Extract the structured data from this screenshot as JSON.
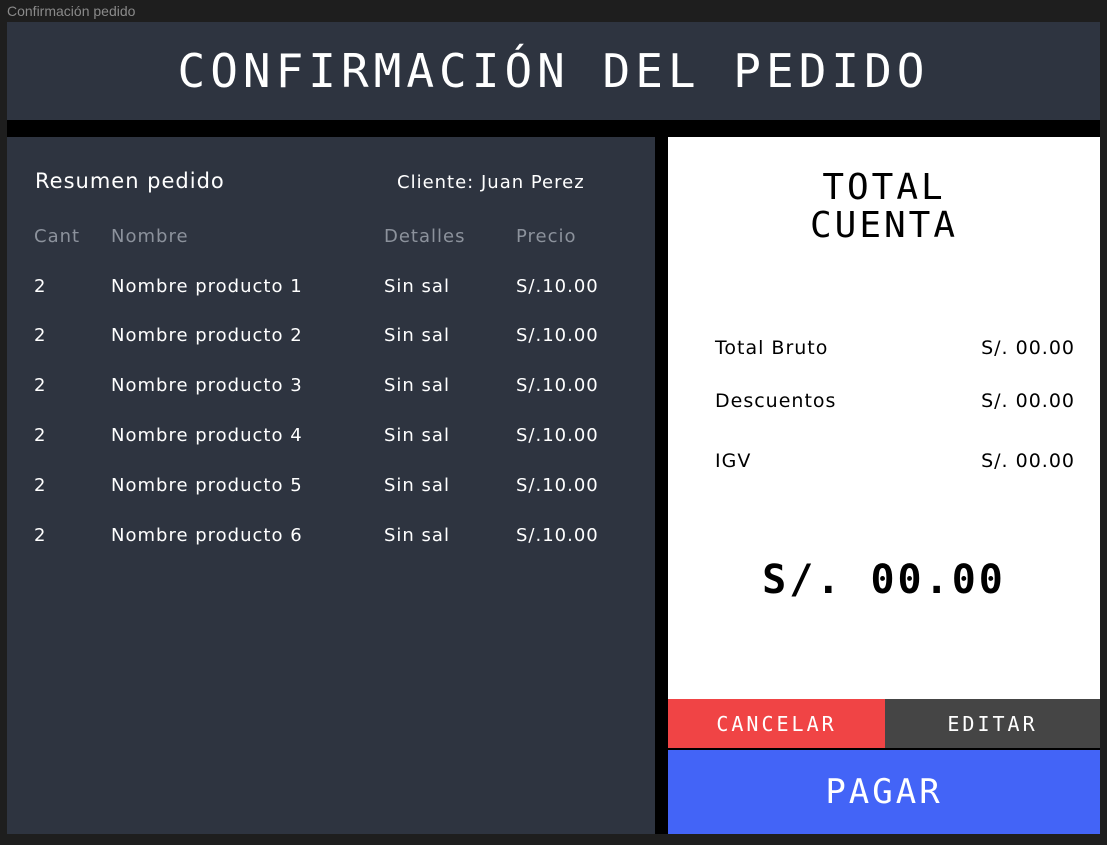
{
  "window": {
    "title": "Confirmación pedido"
  },
  "header": {
    "title": "CONFIRMACIÓN DEL PEDIDO"
  },
  "summary": {
    "title": "Resumen pedido",
    "client": "Cliente: Juan Perez",
    "columns": {
      "cant": "Cant",
      "nombre": "Nombre",
      "detalles": "Detalles",
      "precio": "Precio"
    },
    "items": [
      {
        "cant": "2",
        "nombre": "Nombre producto 1",
        "detalles": "Sin sal",
        "precio": "S/.10.00"
      },
      {
        "cant": "2",
        "nombre": "Nombre producto 2",
        "detalles": "Sin sal",
        "precio": "S/.10.00"
      },
      {
        "cant": "2",
        "nombre": "Nombre producto 3",
        "detalles": "Sin sal",
        "precio": "S/.10.00"
      },
      {
        "cant": "2",
        "nombre": "Nombre producto 4",
        "detalles": "Sin sal",
        "precio": "S/.10.00"
      },
      {
        "cant": "2",
        "nombre": "Nombre producto 5",
        "detalles": "Sin sal",
        "precio": "S/.10.00"
      },
      {
        "cant": "2",
        "nombre": "Nombre producto 6",
        "detalles": "Sin sal",
        "precio": "S/.10.00"
      }
    ]
  },
  "total": {
    "title_line1": "TOTAL",
    "title_line2": "CUENTA",
    "lines": [
      {
        "label": "Total Bruto",
        "value": "S/. 00.00"
      },
      {
        "label": "Descuentos",
        "value": "S/. 00.00"
      },
      {
        "label": "IGV",
        "value": "S/. 00.00"
      }
    ],
    "grand_total": "S/. 00.00"
  },
  "actions": {
    "cancel_label": "CANCELAR",
    "edit_label": "EDITAR",
    "pay_label": "PAGAR"
  },
  "colors": {
    "panel": "#2e3440",
    "cancel": "#f04445",
    "edit": "#454545",
    "pay": "#4364f7"
  }
}
